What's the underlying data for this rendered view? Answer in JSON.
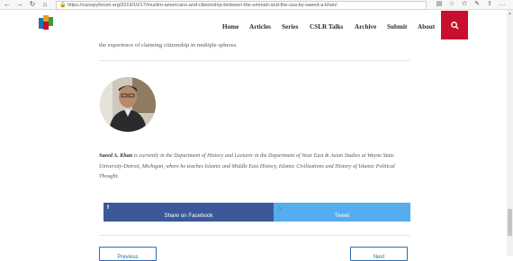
{
  "browser": {
    "back_glyph": "←",
    "forward_glyph": "→",
    "reload_glyph": "↻",
    "home_glyph": "⌂",
    "lock_glyph": "🔒",
    "url": "https://canopyforum.org/2019/10/17/muslim-americans-and-citizenship-between-the-ummah-and-the-usa-by-saeed-a-khan/",
    "reader_glyph": "▤",
    "star_glyph": "☆",
    "favorites_glyph": "✩",
    "pen_glyph": "✎",
    "share_glyph": "⇪",
    "more_glyph": "…"
  },
  "header": {
    "menu": [
      "Home",
      "Articles",
      "Series",
      "CSLR Talks",
      "Archive",
      "Submit",
      "About"
    ],
    "logo_colors": [
      "#1f6fb5",
      "#e6a11a",
      "#c8102e",
      "#3a9a3a"
    ],
    "search_color": "#c8102e"
  },
  "article": {
    "intro_text": "the experience of claiming citizenship in multiple spheres.",
    "author_name": "Saeed A. Khan",
    "bio_text": " is currently in the Department of History and Lecturer in the Department of Near East & Asian Studies at Wayne State University-Detroit, Michigan, where he teaches Islamic and Middle East History, Islamic Civilizations and History of Islamic Political Thought."
  },
  "share": {
    "facebook_icon": "f",
    "facebook_label": "Share on Facebook",
    "twitter_icon": "🐦",
    "twitter_label": "Tweet",
    "facebook_color": "#3b5998",
    "twitter_color": "#55acee"
  },
  "pager": {
    "prev_label": "Previous",
    "next_label": "Next"
  }
}
